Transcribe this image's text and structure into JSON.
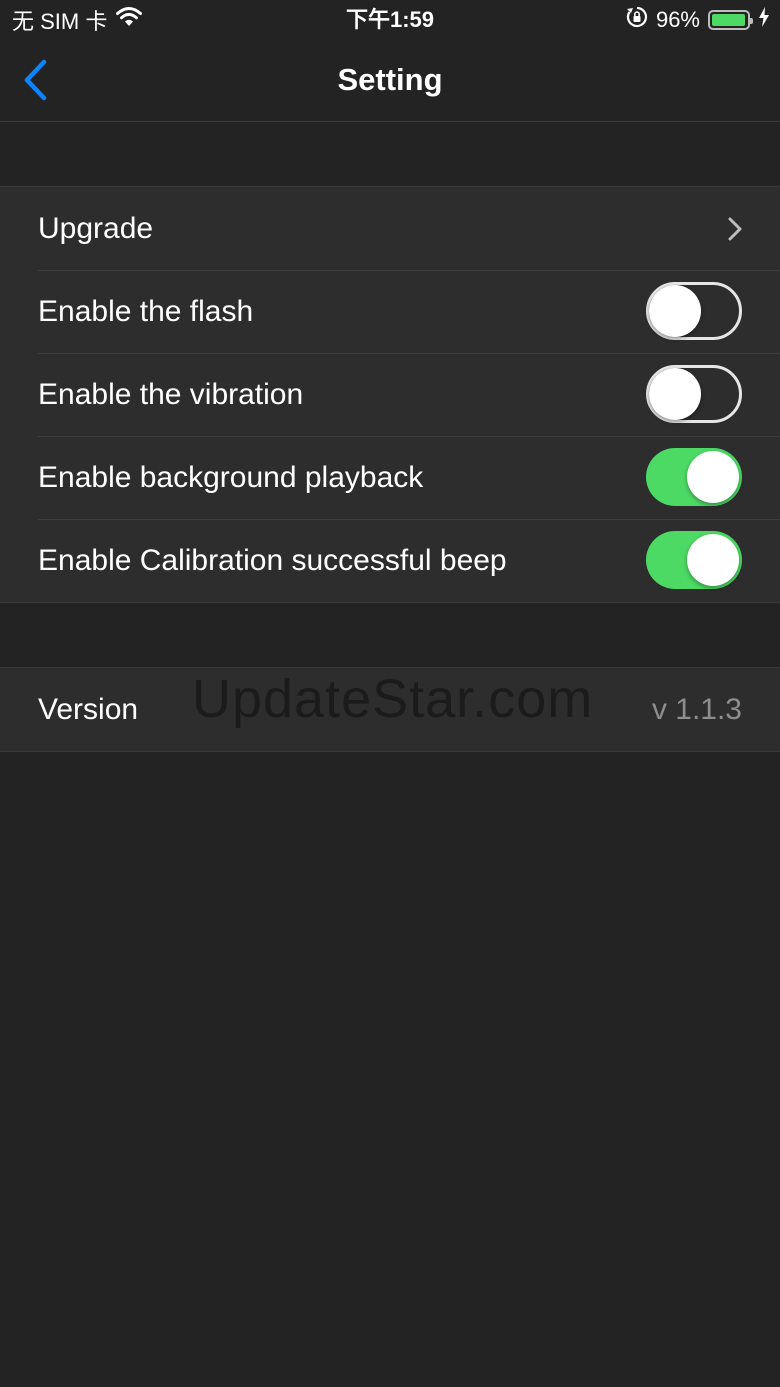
{
  "status_bar": {
    "carrier": "无 SIM 卡",
    "time": "下午1:59",
    "battery_percent": "96%",
    "battery_level": 0.96
  },
  "nav": {
    "title": "Setting"
  },
  "settings": {
    "upgrade_label": "Upgrade",
    "toggles": [
      {
        "label": "Enable the flash",
        "on": false
      },
      {
        "label": "Enable the vibration",
        "on": false
      },
      {
        "label": "Enable background playback",
        "on": true
      },
      {
        "label": "Enable Calibration successful beep",
        "on": true
      }
    ]
  },
  "about": {
    "version_label": "Version",
    "version_value": "v 1.1.3"
  },
  "watermark": "UpdateStar.com",
  "colors": {
    "accent": "#0a84ff",
    "switch_on": "#4cd964",
    "background": "#232323",
    "cell": "#2d2d2d"
  }
}
